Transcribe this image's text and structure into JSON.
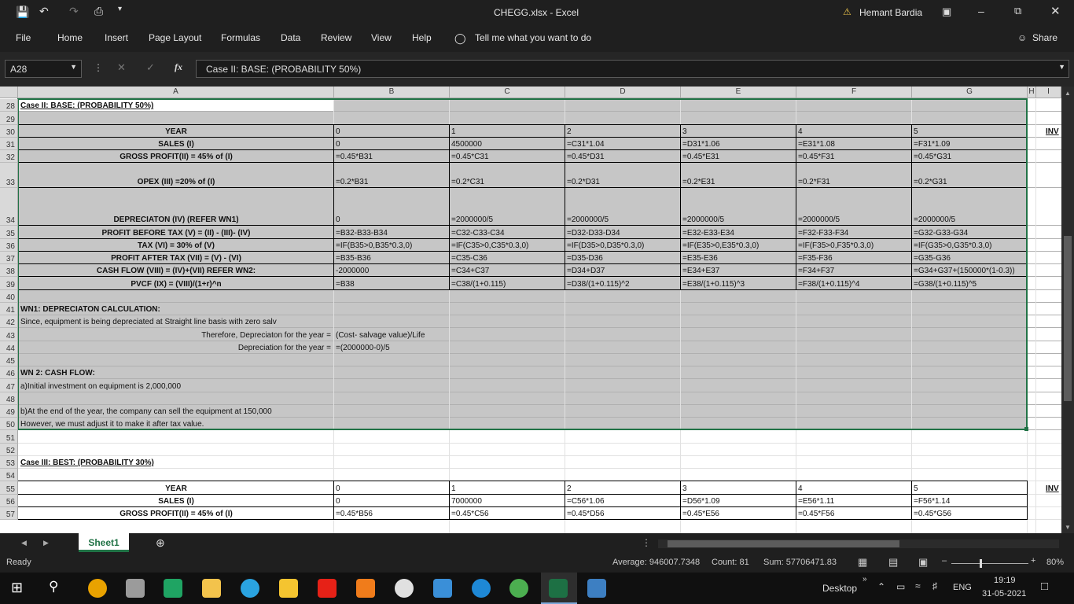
{
  "titlebar": {
    "doc_title": "CHEGG.xlsx  -  Excel",
    "user": "Hemant Bardia"
  },
  "ribbon": {
    "tabs": [
      "File",
      "Home",
      "Insert",
      "Page Layout",
      "Formulas",
      "Data",
      "Review",
      "View",
      "Help"
    ],
    "tell_me": "Tell me what you want to do",
    "share": "Share"
  },
  "formula_bar": {
    "name_box": "A28",
    "formula": "Case II: BASE: (PROBABILITY 50%)"
  },
  "columns": [
    "A",
    "B",
    "C",
    "D",
    "E",
    "F",
    "G",
    "H",
    "I"
  ],
  "rows": {
    "r28": "Case II: BASE: (PROBABILITY 50%)",
    "r30": [
      "YEAR",
      "0",
      "1",
      "2",
      "3",
      "4",
      "5"
    ],
    "r31": [
      "SALES (I)",
      "0",
      "4500000",
      "=C31*1.04",
      "=D31*1.06",
      "=E31*1.08",
      "=F31*1.09"
    ],
    "r32": [
      "GROSS PROFIT(II) = 45% of (I)",
      "=0.45*B31",
      "=0.45*C31",
      "=0.45*D31",
      "=0.45*E31",
      "=0.45*F31",
      "=0.45*G31"
    ],
    "r33": [
      "OPEX (III) =20% of (I)",
      "=0.2*B31",
      "=0.2*C31",
      "=0.2*D31",
      "=0.2*E31",
      "=0.2*F31",
      "=0.2*G31"
    ],
    "r34": [
      "DEPRECIATON (IV) (REFER WN1)",
      "0",
      "=2000000/5",
      "=2000000/5",
      "=2000000/5",
      "=2000000/5",
      "=2000000/5"
    ],
    "r35": [
      "PROFIT BEFORE TAX (V) = (II) - (III)- (IV)",
      "=B32-B33-B34",
      "=C32-C33-C34",
      "=D32-D33-D34",
      "=E32-E33-E34",
      "=F32-F33-F34",
      "=G32-G33-G34"
    ],
    "r36": [
      "TAX (VI) = 30% of (V)",
      "=IF(B35>0,B35*0.3,0)",
      "=IF(C35>0,C35*0.3,0)",
      "=IF(D35>0,D35*0.3,0)",
      "=IF(E35>0,E35*0.3,0)",
      "=IF(F35>0,F35*0.3,0)",
      "=IF(G35>0,G35*0.3,0)"
    ],
    "r37": [
      "PROFIT AFTER TAX (VII) = (V) - (VI)",
      "=B35-B36",
      "=C35-C36",
      "=D35-D36",
      "=E35-E36",
      "=F35-F36",
      "=G35-G36"
    ],
    "r38": [
      "CASH FLOW (VIII) = (IV)+(VII) REFER WN2:",
      "-2000000",
      "=C34+C37",
      "=D34+D37",
      "=E34+E37",
      "=F34+F37",
      "=G34+G37+(150000*(1-0.3))"
    ],
    "r39": [
      "PVCF (IX) = (VIII)/(1+r)^n",
      "=B38",
      "=C38/(1+0.115)",
      "=D38/(1+0.115)^2",
      "=E38/(1+0.115)^3",
      "=F38/(1+0.115)^4",
      "=G38/(1+0.115)^5"
    ],
    "r41": "WN1: DEPRECIATON CALCULATION:",
    "r42": "Since, equipment is being depreciated at Straight line basis with zero salv",
    "r43": [
      "Therefore, Depreciaton for the year =",
      "(Cost- salvage value)/Life"
    ],
    "r44": [
      "Depreciation for the year =",
      "=(2000000-0)/5"
    ],
    "r46": "WN 2: CASH FLOW:",
    "r47": "a)Initial investment on equipment is 2,000,000",
    "r49": "b)At the end of the year, the company can sell the equipment at 150,000",
    "r50": "However, we must adjust it to make it after tax value.",
    "r53": "Case III: BEST: (PROBABILITY 30%)",
    "r55": [
      "YEAR",
      "0",
      "1",
      "2",
      "3",
      "4",
      "5"
    ],
    "r56": [
      "SALES (I)",
      "0",
      "7000000",
      "=C56*1.06",
      "=D56*1.09",
      "=E56*1.11",
      "=F56*1.14"
    ],
    "r57": [
      "GROSS PROFIT(II) = 45% of (I)",
      "=0.45*B56",
      "=0.45*C56",
      "=0.45*D56",
      "=0.45*E56",
      "=0.45*F56",
      "=0.45*G56"
    ],
    "i_col": "INV"
  },
  "sheet": {
    "tab": "Sheet1"
  },
  "status": {
    "ready": "Ready",
    "average": "Average: 946007.7348",
    "count": "Count: 81",
    "sum": "Sum: 57706471.83",
    "zoom": "80%"
  },
  "taskbar": {
    "desktop": "Desktop",
    "lang": "ENG",
    "time": "19:19",
    "date": "31-05-2021"
  }
}
